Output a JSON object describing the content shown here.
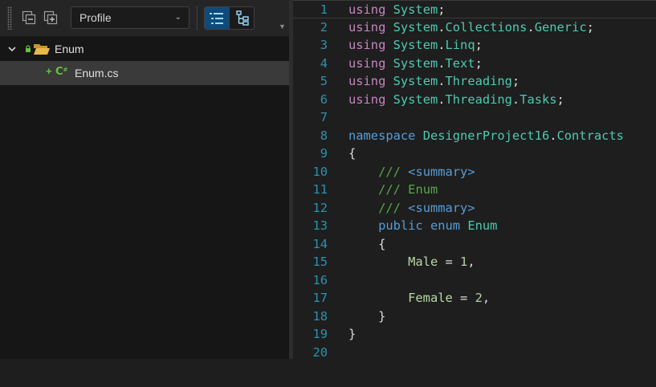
{
  "toolbar": {
    "collapse_icon": "collapse-all-icon",
    "expand_icon": "expand-all-icon",
    "profile_value": "Profile",
    "view_list_icon": "list-view-icon",
    "view_tree_icon": "tree-view-icon"
  },
  "tree": {
    "project": {
      "label": "Enum",
      "icon": "folder-open-icon",
      "expanded": true
    },
    "file": {
      "label": "Enum.cs",
      "icon": "csharp-file-icon",
      "status": "added"
    }
  },
  "editor": {
    "line_numbers": [
      "1",
      "2",
      "3",
      "4",
      "5",
      "6",
      "7",
      "8",
      "9",
      "10",
      "11",
      "12",
      "13",
      "14",
      "15",
      "16",
      "17",
      "18",
      "19",
      "20"
    ],
    "tokens": {
      "using": "using",
      "System": "System",
      "dot": ".",
      "semi": ";",
      "Collections": "Collections",
      "Generic": "Generic",
      "Linq": "Linq",
      "Text": "Text",
      "Threading": "Threading",
      "Tasks": "Tasks",
      "namespace": "namespace",
      "DesignerProject16": "DesignerProject16",
      "Contracts": "Contracts",
      "open_brace": "{",
      "close_brace": "}",
      "triple_slash": "///",
      "summary_open": "<summary>",
      "summary_close": "<summary>",
      "comment_text": "Enum",
      "public": "public",
      "enum": "enum",
      "Enum": "Enum",
      "Male": "Male",
      "Female": "Female",
      "eq": " = ",
      "one": "1",
      "two": "2",
      "comma": ","
    }
  },
  "colors": {
    "keyword_pink": "#c586c0",
    "keyword_blue": "#569cd6",
    "type_teal": "#4ec9b0",
    "comment_green": "#57a64a",
    "number": "#b5cea8",
    "line_number": "#2b91af",
    "selection_accent": "#0e4a7a"
  }
}
